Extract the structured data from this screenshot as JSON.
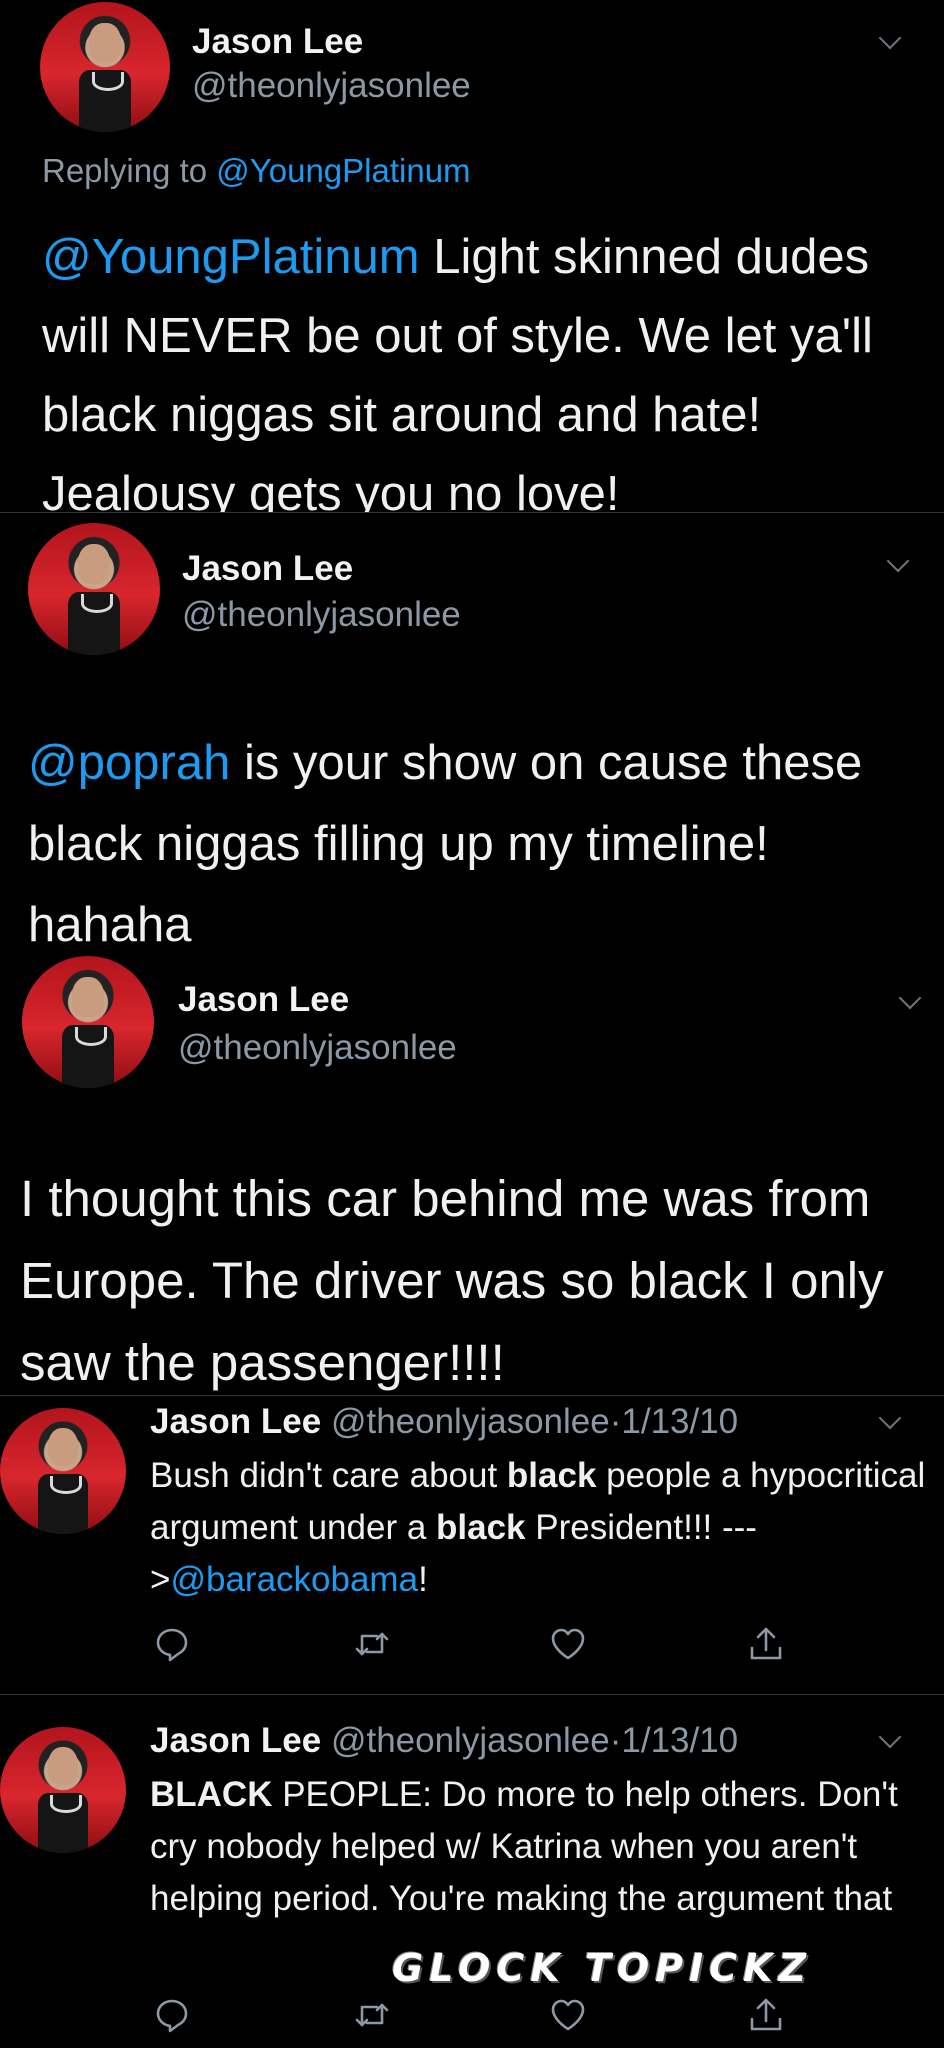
{
  "tweets": [
    {
      "name": "Jason Lee",
      "handle": "@theonlyjasonlee",
      "replying_prefix": "Replying to ",
      "replying_to": "@YoungPlatinum",
      "mention": "@YoungPlatinum",
      "text": " Light skinned dudes will NEVER be out of style. We let ya'll black niggas sit around and hate! Jealousy gets you no love!"
    },
    {
      "name": "Jason Lee",
      "handle": "@theonlyjasonlee",
      "mention": "@poprah",
      "text": " is your show on cause these black niggas filling up my timeline! hahaha"
    },
    {
      "name": "Jason Lee",
      "handle": "@theonlyjasonlee",
      "text": "I thought this car behind me was from Europe. The driver was so black I only saw the passenger!!!!"
    },
    {
      "name": "Jason Lee",
      "handle": "@theonlyjasonlee",
      "sep": "·",
      "date": "1/13/10",
      "text_a": "Bush didn't care about ",
      "bold_a": "black",
      "text_b": " people a hypocritical argument under a ",
      "bold_b": "black",
      "text_c": " President!!! --->",
      "mention": "@barackobama",
      "text_d": "!"
    },
    {
      "name": "Jason Lee",
      "handle": "@theonlyjasonlee",
      "sep": "·",
      "date": "1/13/10",
      "bold_a": "BLACK",
      "text_a": " PEOPLE: Do more to help others. Don't cry nobody helped w/ Katrina when you aren't helping period. You're making the argument that"
    }
  ],
  "icons": [
    "reply-icon",
    "retweet-icon",
    "like-icon",
    "share-icon",
    "chevron-down-icon"
  ],
  "watermark": "GLOCK TOPICKZ",
  "colors": {
    "background": "#000000",
    "link": "#1d9bf0",
    "secondary": "#8b98a5"
  }
}
